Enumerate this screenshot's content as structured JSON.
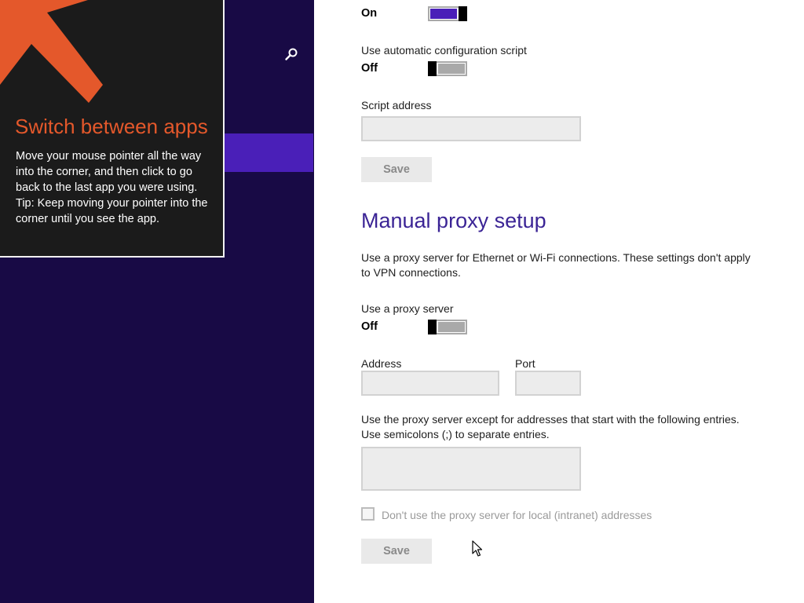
{
  "tip": {
    "title": "Switch between apps",
    "line1": "Move your mouse pointer all the way into the corner, and then click to go back to the last app you were using.",
    "line2": "Tip: Keep moving your pointer into the corner until you see the app."
  },
  "auto_detect": {
    "state": "On"
  },
  "auto_script": {
    "label": "Use automatic configuration script",
    "state": "Off",
    "address_label": "Script address",
    "address_value": "",
    "save_label": "Save"
  },
  "manual": {
    "title": "Manual proxy setup",
    "description": "Use a proxy server for Ethernet or Wi-Fi connections. These settings don't apply to VPN connections.",
    "use_proxy_label": "Use a proxy server",
    "use_proxy_state": "Off",
    "address_label": "Address",
    "address_value": "",
    "port_label": "Port",
    "port_value": "",
    "exceptions_text": "Use the proxy server except for addresses that start with the following entries. Use semicolons (;) to separate entries.",
    "exceptions_value": "",
    "local_bypass_label": "Don't use the proxy server for local (intranet) addresses",
    "local_bypass_checked": false,
    "save_label": "Save"
  },
  "colors": {
    "left_background": "#180a45",
    "accent": "#4a1fb8",
    "tip_background": "#1b1b1b",
    "tip_title": "#e4582b",
    "section_title": "#3b2495"
  },
  "icons": {
    "search": "search-icon",
    "tip_arrow": "arrow-up-left-icon",
    "cursor": "mouse-pointer-icon"
  }
}
